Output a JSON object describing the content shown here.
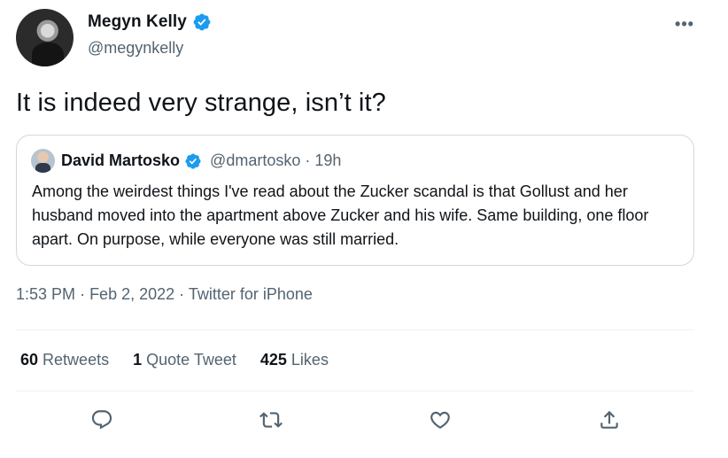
{
  "author": {
    "display_name": "Megyn Kelly",
    "handle": "@megynkelly",
    "verified": true
  },
  "tweet": {
    "text": "It is indeed very strange, isn’t it?",
    "time": "1:53 PM",
    "date": "Feb 2, 2022",
    "source": "Twitter for iPhone",
    "separator": "·"
  },
  "quoted_tweet": {
    "display_name": "David Martosko",
    "handle": "@dmartosko",
    "age": "19h",
    "verified": true,
    "text": "Among the weirdest things I've read about the Zucker scandal is that Gollust and her husband moved into the apartment above Zucker and his wife. Same building, one floor apart. On purpose, while everyone was still married."
  },
  "stats": {
    "retweets_count": "60",
    "retweets_label": "Retweets",
    "quotes_count": "1",
    "quotes_label": "Quote Tweet",
    "likes_count": "425",
    "likes_label": "Likes"
  },
  "more_glyph": "•••",
  "icons": [
    "verified-badge-icon",
    "more-icon",
    "reply-icon",
    "retweet-icon",
    "like-icon",
    "share-icon"
  ],
  "colors": {
    "verified_blue": "#1d9bf0",
    "secondary_text": "#536471",
    "border": "#cfd9de"
  }
}
